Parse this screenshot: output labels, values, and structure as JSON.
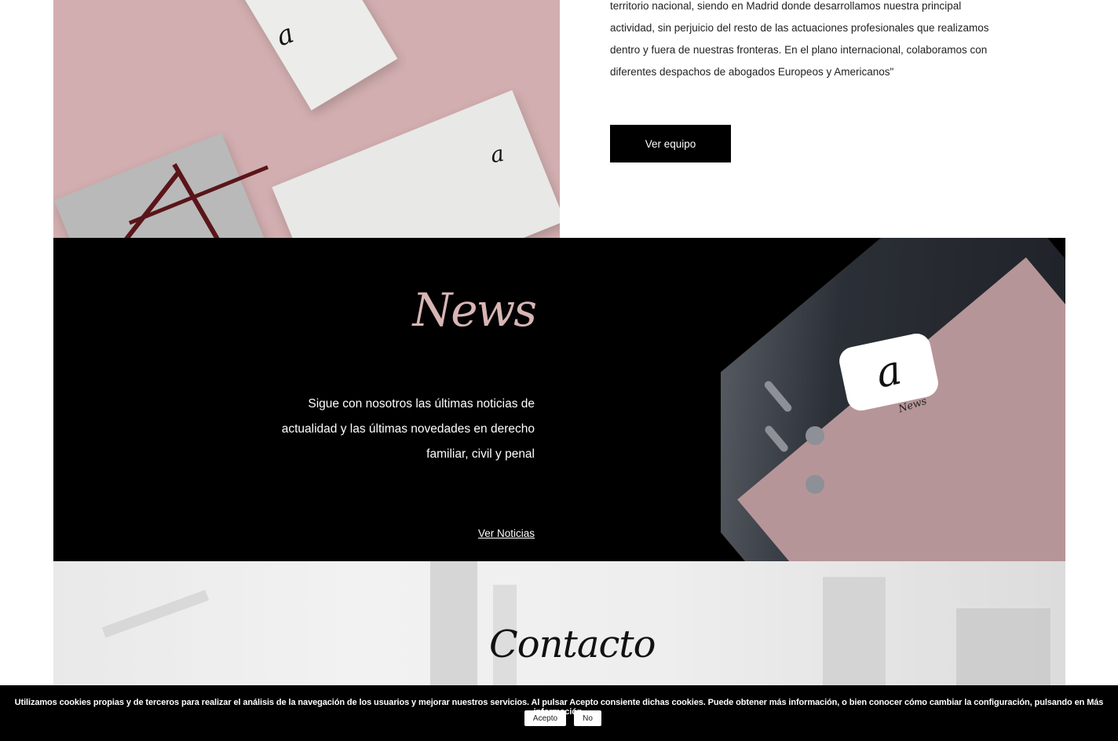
{
  "about": {
    "paragraph_lines": [
      "territorio nacional, siendo en Madrid donde desarrollamos nuestra principal",
      "actividad, sin perjuicio del resto de las actuaciones profesionales que realizamos",
      "dentro y fuera de nuestras fronteras. En el plano internacional, colaboramos con",
      "diferentes despachos de abogados Europeos y Americanos\""
    ],
    "team_button": "Ver equipo"
  },
  "news": {
    "title": "News",
    "description_lines": [
      "Sigue con nosotros las últimas noticias de",
      "actualidad y las últimas novedades en derecho",
      "familiar, civil y penal"
    ],
    "link": "Ver Noticias",
    "app_icon_letter": "a",
    "app_label": "News",
    "accent_color": "#d8b5b5"
  },
  "contact": {
    "title": "Contacto"
  },
  "cookies": {
    "text": "Utilizamos cookies propias y de terceros para realizar el análisis de la navegación de los usuarios y mejorar nuestros servicios. Al pulsar Acepto consiente dichas cookies. Puede obtener más información, o bien conocer cómo cambiar la configuración, pulsando en Más información.",
    "accept": "Acepto",
    "decline": "No"
  }
}
